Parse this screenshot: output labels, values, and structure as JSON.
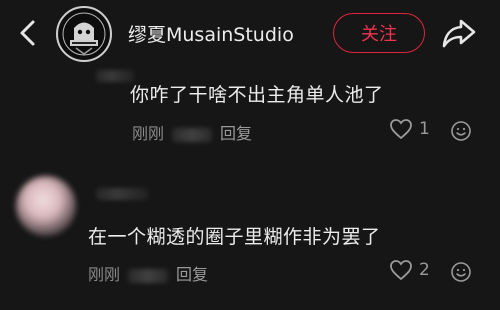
{
  "header": {
    "username": "缪夏MusainStudio",
    "follow_label": "关注"
  },
  "comments": [
    {
      "text": "你咋了干啥不出主角单人池了",
      "time": "刚刚",
      "reply_label": "回复",
      "likes": "1"
    },
    {
      "text": "在一个糊透的圈子里糊作非为罢了",
      "time": "刚刚",
      "reply_label": "回复",
      "likes": "2"
    }
  ],
  "colors": {
    "background": "#161616",
    "accent": "#ef3350",
    "text_primary": "#ececec",
    "text_secondary": "#8a8a8a"
  },
  "icons": {
    "back": "chevron-left-icon",
    "share": "share-arrow-icon",
    "like": "heart-outline-icon",
    "emoji": "smiley-icon"
  }
}
